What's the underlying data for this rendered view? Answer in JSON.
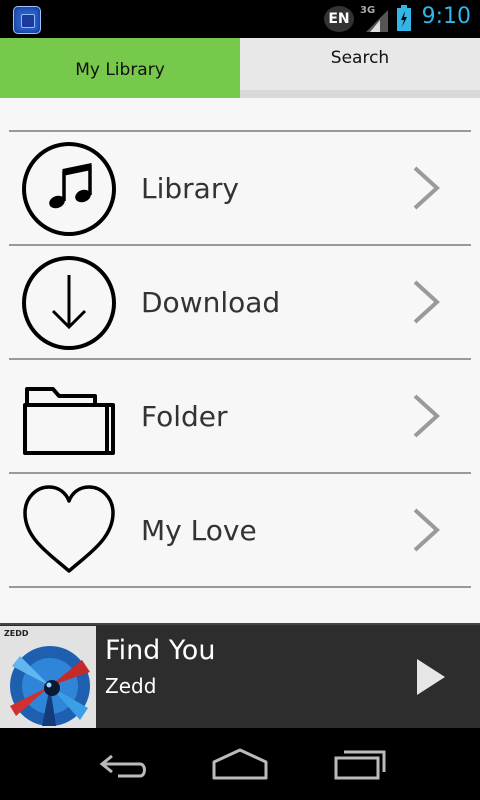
{
  "status_bar": {
    "language": "EN",
    "network": "3G",
    "time": "9:10"
  },
  "tabs": [
    {
      "label": "My Library",
      "selected": true
    },
    {
      "label": "Search",
      "selected": false
    }
  ],
  "menu": {
    "items": [
      {
        "label": "Library",
        "icon": "music-note-icon"
      },
      {
        "label": "Download",
        "icon": "download-icon"
      },
      {
        "label": "Folder",
        "icon": "folder-icon"
      },
      {
        "label": "My Love",
        "icon": "heart-icon"
      }
    ]
  },
  "now_playing": {
    "title": "Find You",
    "artist": "Zedd",
    "cover_text": "ZEDD"
  },
  "colors": {
    "tab_selected": "#76c94a",
    "tab_unselected": "#e8e8e8",
    "status_accent": "#33b5e5",
    "player_bg": "#2d2d2d"
  }
}
